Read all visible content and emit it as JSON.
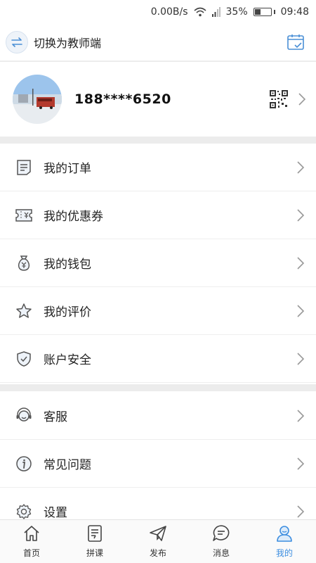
{
  "status_bar": {
    "speed": "0.00B/s",
    "battery_percent": "35%",
    "battery_level": 0.35,
    "time": "09:48",
    "icons": [
      "wifi-icon",
      "signal-icon",
      "battery-icon"
    ]
  },
  "top_bar": {
    "switch_label": "切换为教师端",
    "switch_icon": "swap-icon",
    "calendar_icon": "calendar-check-icon"
  },
  "profile": {
    "phone": "188****6520",
    "qr_icon": "qr-code-icon"
  },
  "menu_group_1": [
    {
      "label": "我的订单",
      "icon": "order-icon"
    },
    {
      "label": "我的优惠券",
      "icon": "coupon-icon"
    },
    {
      "label": "我的钱包",
      "icon": "wallet-icon"
    },
    {
      "label": "我的评价",
      "icon": "star-icon"
    },
    {
      "label": "账户安全",
      "icon": "shield-icon"
    }
  ],
  "menu_group_2": [
    {
      "label": "客服",
      "icon": "headset-icon"
    },
    {
      "label": "常见问题",
      "icon": "info-icon"
    },
    {
      "label": "设置",
      "icon": "gear-icon"
    }
  ],
  "bottom_nav": [
    {
      "label": "首页",
      "icon": "home-icon"
    },
    {
      "label": "拼课",
      "icon": "course-icon"
    },
    {
      "label": "发布",
      "icon": "send-icon"
    },
    {
      "label": "消息",
      "icon": "message-icon"
    },
    {
      "label": "我的",
      "icon": "user-icon",
      "active": true
    }
  ],
  "colors": {
    "accent": "#3d8ee0",
    "icon_gray": "#555555",
    "divider": "#ececec"
  }
}
